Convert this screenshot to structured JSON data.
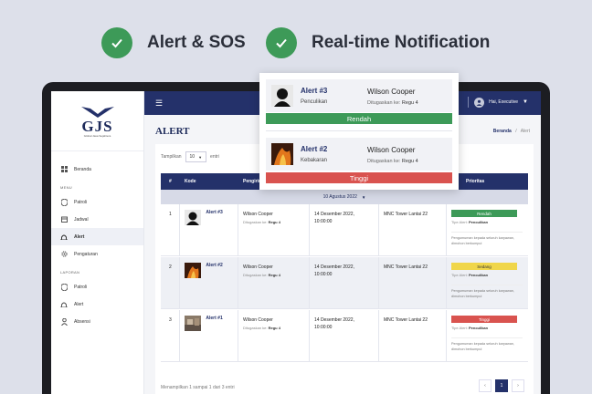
{
  "hero": {
    "features": [
      "Alert & SOS",
      "Real-time Notification"
    ]
  },
  "sidebar": {
    "logo_text": "GJS",
    "logo_sub": "Global Jasa Sejahtera",
    "menu_label": "MENU",
    "menu": [
      "Beranda",
      "Patroli",
      "Jadwal",
      "Alert",
      "Pengaturan"
    ],
    "report_label": "LAPORAN",
    "reports": [
      "Patroli",
      "Alert",
      "Absensi"
    ]
  },
  "topbar": {
    "user": "Hai, Executive"
  },
  "page": {
    "title": "ALERT",
    "breadcrumb_home": "Beranda",
    "breadcrumb_sep": "/",
    "breadcrumb_current": "Alert"
  },
  "table": {
    "show_label": "Tampilkan",
    "show_value": "10",
    "show_suffix": "entri",
    "headers": [
      "#",
      "Kode",
      "Pengirim",
      "",
      "",
      "Prioritas"
    ],
    "group_date": "10 Agustus 2022",
    "rows": [
      {
        "no": "1",
        "code": "Alert #3",
        "name": "Wilson Cooper",
        "assigned_label": "Ditugaskan ke:",
        "assigned": "Regu 4",
        "date": "14 Desember 2022,",
        "time": "10:00:00",
        "location": "MNC Tower Lantai 22",
        "priority": "Rendah",
        "type_label": "Tipe Alert:",
        "type": "Penculikan",
        "note": "Pengumuman kepada seluruh karyawan, dimohon berkumpul"
      },
      {
        "no": "2",
        "code": "Alert #2",
        "name": "Wilson Cooper",
        "assigned_label": "Ditugaskan ke:",
        "assigned": "Regu 4",
        "date": "14 Desember 2022,",
        "time": "10:00:00",
        "location": "MNC Tower Lantai 22",
        "priority": "Sedang",
        "type_label": "Tipe Alert:",
        "type": "Penculikan",
        "note": "Pengumuman kepada seluruh karyawan, dimohon berkumpul"
      },
      {
        "no": "3",
        "code": "Alert #1",
        "name": "Wilson Cooper",
        "assigned_label": "Ditugaskan ke:",
        "assigned": "Regu 4",
        "date": "14 Desember 2022,",
        "time": "10:00:00",
        "location": "MNC Tower Lantai 22",
        "priority": "Tinggi",
        "type_label": "Tipe Alert:",
        "type": "Penculikan",
        "note": "Pengumuman kepada seluruh karyawan, dimohon berkumpul"
      }
    ],
    "footer": "Menampilkan 1 sampai 1 dari 3 entri",
    "page": "1"
  },
  "popup": {
    "items": [
      {
        "title": "Alert #3",
        "subtitle": "Penculikan",
        "name": "Wilson Cooper",
        "assigned_label": "Ditugaskan ke:",
        "assigned": "Regu 4",
        "priority": "Rendah"
      },
      {
        "title": "Alert #2",
        "subtitle": "Kebakaran",
        "name": "Wilson Cooper",
        "assigned_label": "Ditugaskan ke:",
        "assigned": "Regu 4",
        "priority": "Tinggi"
      }
    ]
  },
  "colors": {
    "navy": "#24316a",
    "green": "#3d9a58",
    "yellow": "#f0d64a",
    "red": "#d9534f"
  }
}
